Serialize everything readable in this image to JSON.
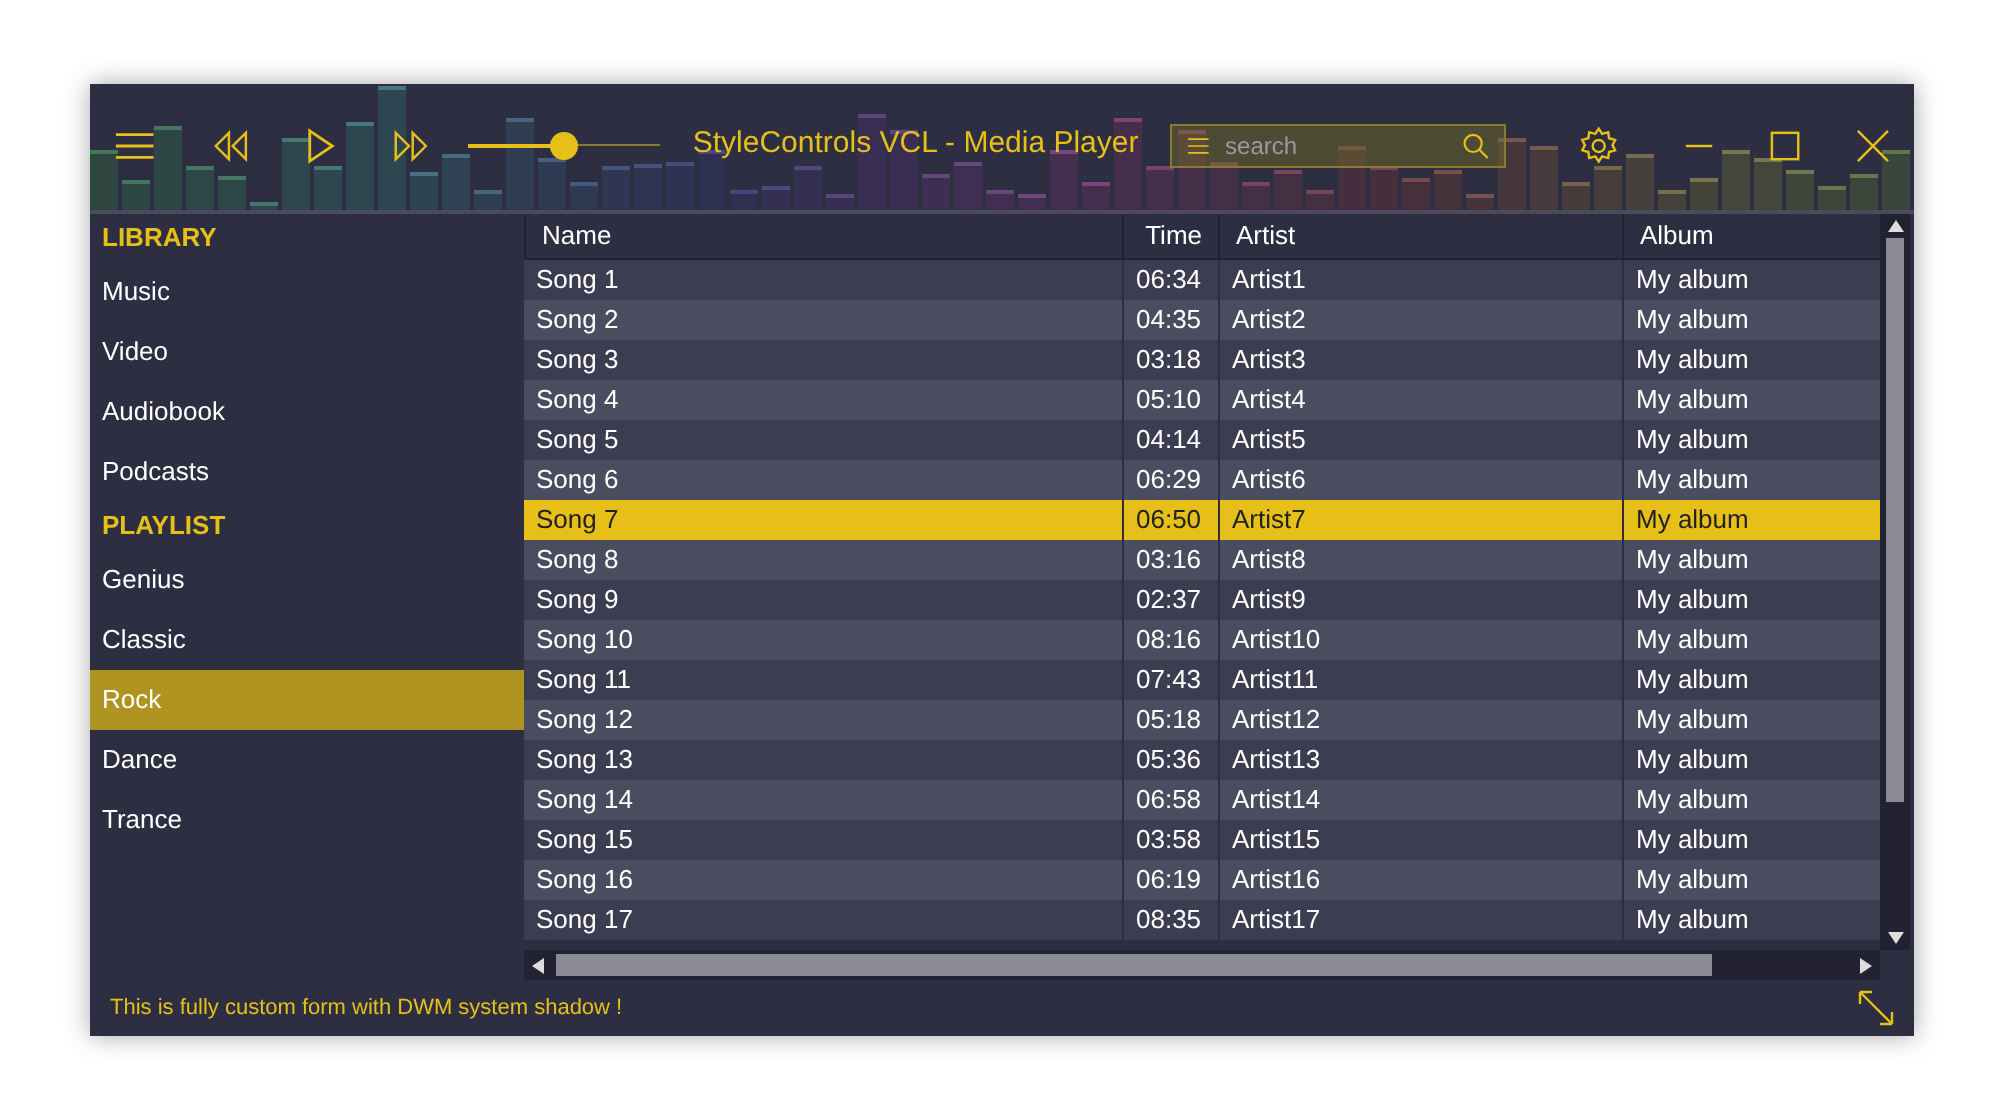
{
  "window": {
    "title": "StyleControls VCL - Media Player"
  },
  "volume": {
    "level": 0.5
  },
  "search": {
    "placeholder": "search"
  },
  "sidebar": {
    "sections": [
      {
        "title": "LIBRARY",
        "items": [
          {
            "label": "Music",
            "selected": false
          },
          {
            "label": "Video",
            "selected": false
          },
          {
            "label": "Audiobook",
            "selected": false
          },
          {
            "label": "Podcasts",
            "selected": false
          }
        ]
      },
      {
        "title": "PLAYLIST",
        "items": [
          {
            "label": "Genius",
            "selected": false
          },
          {
            "label": "Classic",
            "selected": false
          },
          {
            "label": "Rock",
            "selected": true
          },
          {
            "label": "Dance",
            "selected": false
          },
          {
            "label": "Trance",
            "selected": false
          }
        ]
      }
    ]
  },
  "table": {
    "columns": [
      "Name",
      "Time",
      "Artist",
      "Album"
    ],
    "rows": [
      {
        "cells": [
          "Song 1",
          "06:34",
          "Artist1",
          "My album"
        ],
        "selected": false
      },
      {
        "cells": [
          "Song 2",
          "04:35",
          "Artist2",
          "My album"
        ],
        "selected": false
      },
      {
        "cells": [
          "Song 3",
          "03:18",
          "Artist3",
          "My album"
        ],
        "selected": false
      },
      {
        "cells": [
          "Song 4",
          "05:10",
          "Artist4",
          "My album"
        ],
        "selected": false
      },
      {
        "cells": [
          "Song 5",
          "04:14",
          "Artist5",
          "My album"
        ],
        "selected": false
      },
      {
        "cells": [
          "Song 6",
          "06:29",
          "Artist6",
          "My album"
        ],
        "selected": false
      },
      {
        "cells": [
          "Song 7",
          "06:50",
          "Artist7",
          "My album"
        ],
        "selected": true
      },
      {
        "cells": [
          "Song 8",
          "03:16",
          "Artist8",
          "My album"
        ],
        "selected": false
      },
      {
        "cells": [
          "Song 9",
          "02:37",
          "Artist9",
          "My album"
        ],
        "selected": false
      },
      {
        "cells": [
          "Song 10",
          "08:16",
          "Artist10",
          "My album"
        ],
        "selected": false
      },
      {
        "cells": [
          "Song 11",
          "07:43",
          "Artist11",
          "My album"
        ],
        "selected": false
      },
      {
        "cells": [
          "Song 12",
          "05:18",
          "Artist12",
          "My album"
        ],
        "selected": false
      },
      {
        "cells": [
          "Song 13",
          "05:36",
          "Artist13",
          "My album"
        ],
        "selected": false
      },
      {
        "cells": [
          "Song 14",
          "06:58",
          "Artist14",
          "My album"
        ],
        "selected": false
      },
      {
        "cells": [
          "Song 15",
          "03:58",
          "Artist15",
          "My album"
        ],
        "selected": false
      },
      {
        "cells": [
          "Song 16",
          "06:19",
          "Artist16",
          "My album"
        ],
        "selected": false
      },
      {
        "cells": [
          "Song 17",
          "08:35",
          "Artist17",
          "My album"
        ],
        "selected": false
      }
    ]
  },
  "status_bar": {
    "text": "This is fully custom form with DWM system shadow !"
  }
}
